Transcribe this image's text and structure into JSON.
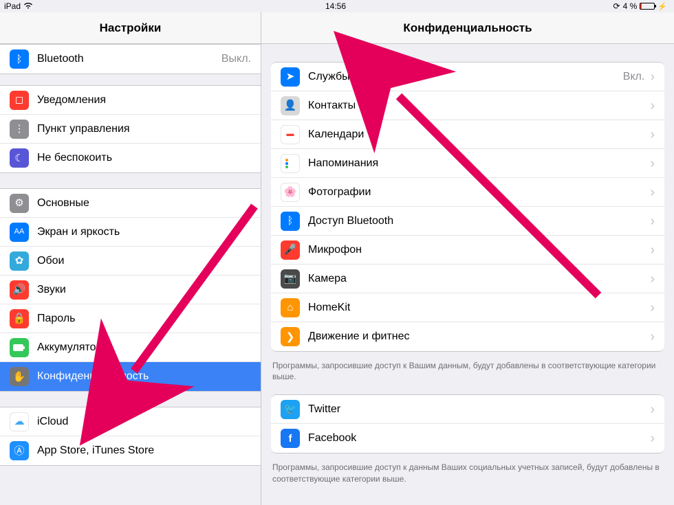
{
  "status": {
    "device": "iPad",
    "time": "14:56",
    "battery_text": "4 %"
  },
  "sidebar": {
    "title": "Настройки",
    "groups": [
      {
        "rows": [
          {
            "icon": "bluetooth",
            "label": "Bluetooth",
            "value": "Выкл."
          }
        ]
      },
      {
        "rows": [
          {
            "icon": "notifications",
            "label": "Уведомления"
          },
          {
            "icon": "control-center",
            "label": "Пункт управления"
          },
          {
            "icon": "do-not-disturb",
            "label": "Не беспокоить"
          }
        ]
      },
      {
        "rows": [
          {
            "icon": "general",
            "label": "Основные"
          },
          {
            "icon": "display",
            "label": "Экран и яркость"
          },
          {
            "icon": "wallpaper",
            "label": "Обои"
          },
          {
            "icon": "sounds",
            "label": "Звуки"
          },
          {
            "icon": "passcode",
            "label": "Пароль"
          },
          {
            "icon": "battery",
            "label": "Аккумулятор"
          },
          {
            "icon": "privacy",
            "label": "Конфиденциальность",
            "selected": true
          }
        ]
      },
      {
        "rows": [
          {
            "icon": "icloud",
            "label": "iCloud"
          },
          {
            "icon": "appstore",
            "label": "App Store, iTunes Store"
          }
        ]
      }
    ]
  },
  "detail": {
    "title": "Конфиденциальность",
    "groups": [
      {
        "rows": [
          {
            "icon": "location",
            "label": "Службы геолокации",
            "value": "Вкл."
          },
          {
            "icon": "contacts",
            "label": "Контакты"
          },
          {
            "icon": "calendar",
            "label": "Календари"
          },
          {
            "icon": "reminders",
            "label": "Напоминания"
          },
          {
            "icon": "photos",
            "label": "Фотографии"
          },
          {
            "icon": "bt-share",
            "label": "Доступ Bluetooth"
          },
          {
            "icon": "microphone",
            "label": "Микрофон"
          },
          {
            "icon": "camera",
            "label": "Камера"
          },
          {
            "icon": "homekit",
            "label": "HomeKit"
          },
          {
            "icon": "motion",
            "label": "Движение и фитнес"
          }
        ],
        "footer": "Программы, запросившие доступ к Вашим данным, будут добавлены в соответствующие категории выше."
      },
      {
        "rows": [
          {
            "icon": "twitter",
            "label": "Twitter"
          },
          {
            "icon": "facebook",
            "label": "Facebook"
          }
        ],
        "footer": "Программы, запросившие доступ к данным Ваших социальных учетных записей, будут добавлены в соответствующие категории выше."
      }
    ]
  }
}
